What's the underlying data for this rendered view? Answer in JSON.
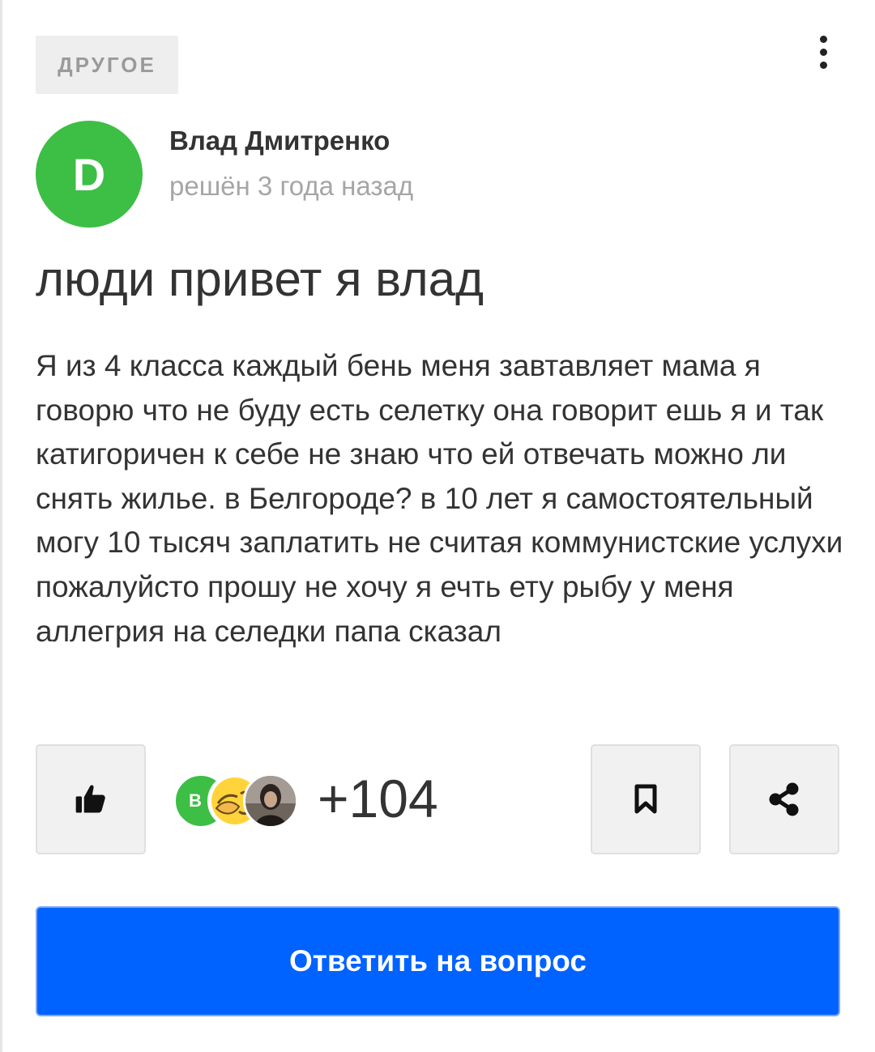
{
  "category": {
    "label": "ДРУГОЕ"
  },
  "author": {
    "avatar_letter": "D",
    "name": "Влад Дмитренко",
    "status": "решён 3 года назад",
    "avatar_color": "#3dbe45"
  },
  "question": {
    "title": "люди привет я влад",
    "body": "Я из 4 класса каждый бень меня завтавляет мама я говорю что не буду есть селетку она говорит ешь я и так катигоричен к себе не знаю что ей отвечать можно ли снять жилье. в Белгороде? в 10 лет я самостоятельный могу 10 тысяч заплатить не считая коммунистские услухи пожалуйсто прошу не хочу я ечть ету рыбу у меня аллегрия на селедки папа сказал"
  },
  "actions": {
    "like_icon": "thumbs-up-icon",
    "bookmark_icon": "bookmark-icon",
    "share_icon": "share-icon",
    "more_icon": "more-vertical-icon"
  },
  "likes": {
    "first_liker_letter": "В",
    "count": "+104"
  },
  "answer_button": {
    "label": "Ответить на вопрос"
  },
  "colors": {
    "primary": "#0062ff",
    "avatar_green": "#3dbe45",
    "muted_text": "#a6a6a6",
    "text": "#333333"
  }
}
